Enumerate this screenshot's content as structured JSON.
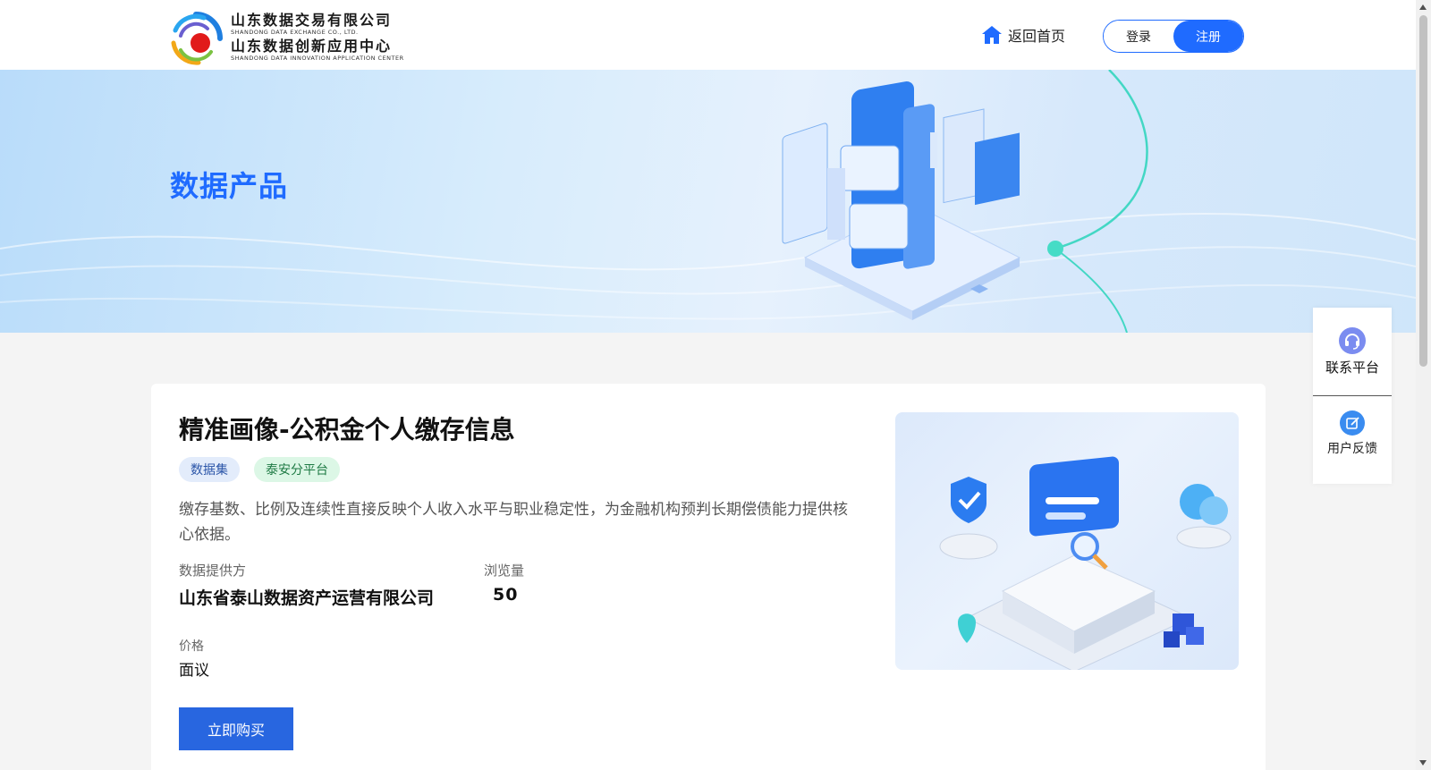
{
  "header": {
    "logo": {
      "line1_cn": "山东数据交易有限公司",
      "line1_en": "SHANDONG DATA EXCHANGE CO., LTD.",
      "line2_cn": "山东数据创新应用中心",
      "line2_en": "SHANDONG DATA INNOVATION APPLICATION CENTER"
    },
    "home_label": "返回首页",
    "login_label": "登录",
    "register_label": "注册"
  },
  "banner": {
    "title": "数据产品"
  },
  "product": {
    "title": "精准画像-公积金个人缴存信息",
    "tags": [
      "数据集",
      "泰安分平台"
    ],
    "description": "缴存基数、比例及连续性直接反映个人收入水平与职业稳定性，为金融机构预判长期偿债能力提供核心依据。",
    "provider_label": "数据提供方",
    "provider_value": "山东省泰山数据资产运营有限公司",
    "views_label": "浏览量",
    "views_value": "50",
    "price_label": "价格",
    "price_value": "面议",
    "buy_label": "立即购买"
  },
  "side_panel": {
    "contact_label": "联系平台",
    "feedback_label": "用户反馈"
  },
  "colors": {
    "primary": "#1f6bff",
    "buy_button": "#2866e0",
    "tag_blue_bg": "#e3ecfb",
    "tag_green_bg": "#dcf7e6"
  },
  "icons": [
    "home-icon",
    "headset-icon",
    "edit-icon"
  ]
}
